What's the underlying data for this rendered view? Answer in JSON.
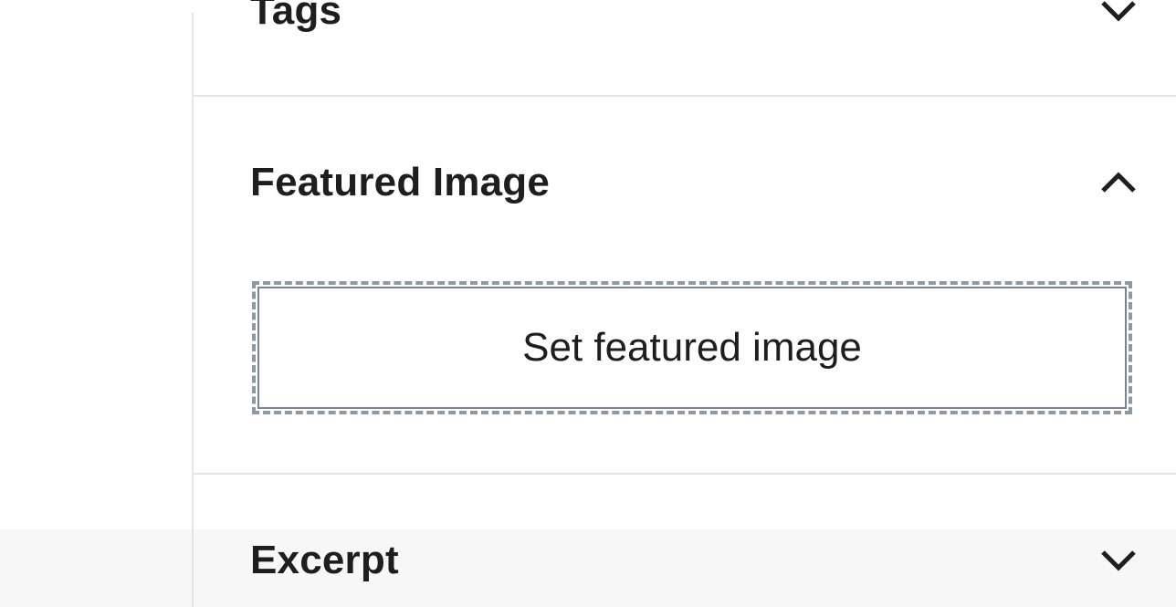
{
  "panels": {
    "tags": {
      "title": "Tags",
      "state": "collapsed",
      "icon": "chevron-down-icon"
    },
    "featured_image": {
      "title": "Featured Image",
      "state": "expanded",
      "icon": "chevron-up-icon",
      "button_label": "Set featured image"
    },
    "excerpt": {
      "title": "Excerpt",
      "state": "collapsed",
      "icon": "chevron-down-icon"
    }
  },
  "colors": {
    "text": "#1e1e1e",
    "divider": "#e2e4e7",
    "dashed_border": "#8e99a6",
    "shade": "#f7f7f7"
  }
}
